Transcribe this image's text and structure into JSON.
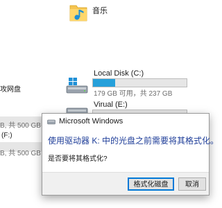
{
  "explorer": {
    "music_folder": {
      "label": "音乐",
      "icon": "music-folder-icon"
    },
    "network_drive_label_partial": "攻网盘",
    "left_drive_1_size_partial": "B, 共 500 GB",
    "left_drive_2_name_partial": "(F:)",
    "left_drive_2_size_partial": "B, 共 500 GB",
    "drives": [
      {
        "name": "Local Disk (C:)",
        "info": "179 GB 可用，共 237 GB",
        "used_fraction": 0.24,
        "icon": "windows-drive-icon"
      },
      {
        "name": "Virual (E:)",
        "info": "",
        "icon": "drive-icon"
      }
    ]
  },
  "dialog": {
    "title": "Microsoft Windows",
    "message": "使用驱动器 K: 中的光盘之前需要将其格式化。",
    "question": "是否要将其格式化?",
    "buttons": {
      "format": "格式化磁盘",
      "cancel": "取消"
    }
  },
  "colors": {
    "accent": "#26a0da",
    "dialog_message": "#1f3e99",
    "button_focus_border": "#0078d7"
  }
}
